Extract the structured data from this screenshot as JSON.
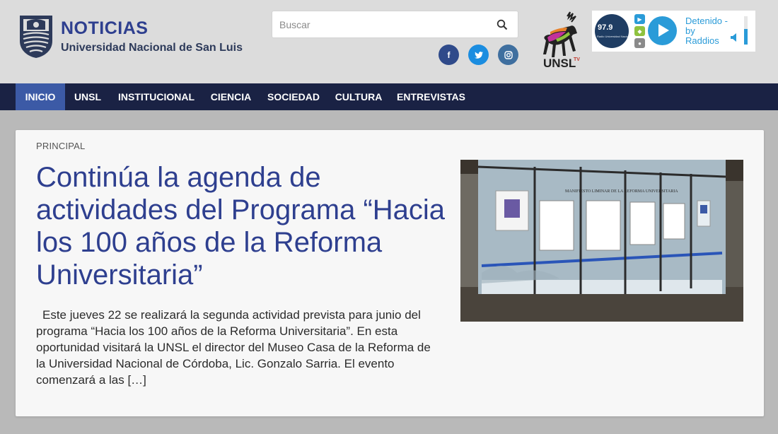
{
  "header": {
    "logo": {
      "title": "NOTICIAS",
      "subtitle": "Universidad Nacional de San Luis"
    },
    "search": {
      "placeholder": "Buscar"
    },
    "social": [
      {
        "name": "facebook-icon",
        "glyph": "f"
      },
      {
        "name": "twitter-icon",
        "glyph": "t"
      },
      {
        "name": "instagram-icon",
        "glyph": "◎"
      }
    ],
    "unsl_tv": {
      "text": "UNSL",
      "sup": "TV"
    },
    "radio": {
      "frequency": "97.9",
      "station_label": "Radio Universidad Nacional de San Luis",
      "status": "Detenido - by Raddios",
      "volume": 0.55,
      "play_color": "#2a9bd8"
    }
  },
  "nav": {
    "items": [
      {
        "label": "INICIO",
        "active": true
      },
      {
        "label": "UNSL",
        "active": false
      },
      {
        "label": "INSTITUCIONAL",
        "active": false
      },
      {
        "label": "CIENCIA",
        "active": false
      },
      {
        "label": "SOCIEDAD",
        "active": false
      },
      {
        "label": "CULTURA",
        "active": false
      },
      {
        "label": "ENTREVISTAS",
        "active": false
      }
    ]
  },
  "article": {
    "category": "PRINCIPAL",
    "title": "Continúa la agenda de actividades del Programa “Hacia los 100 años de la Reforma Universitaria”",
    "excerpt": "Este jueves 22 se realizará la segunda actividad prevista para junio del programa “Hacia los 100 años de la Reforma Universitaria”. En esta oportunidad visitará la UNSL el director del Museo Casa de la Reforma de la Universidad Nacional de Córdoba, Lic. Gonzalo Sarria. El evento comenzará a las […]",
    "image_caption": "MANIFIESTO LIMINAR DE LA REFORMA UNIVERSITARIA"
  },
  "colors": {
    "brand_blue": "#2e3f8f",
    "nav_bg": "#1a2244",
    "nav_active": "#3c5aa6",
    "header_bg": "#dcdcdc",
    "page_bg": "#b9b9b9"
  }
}
